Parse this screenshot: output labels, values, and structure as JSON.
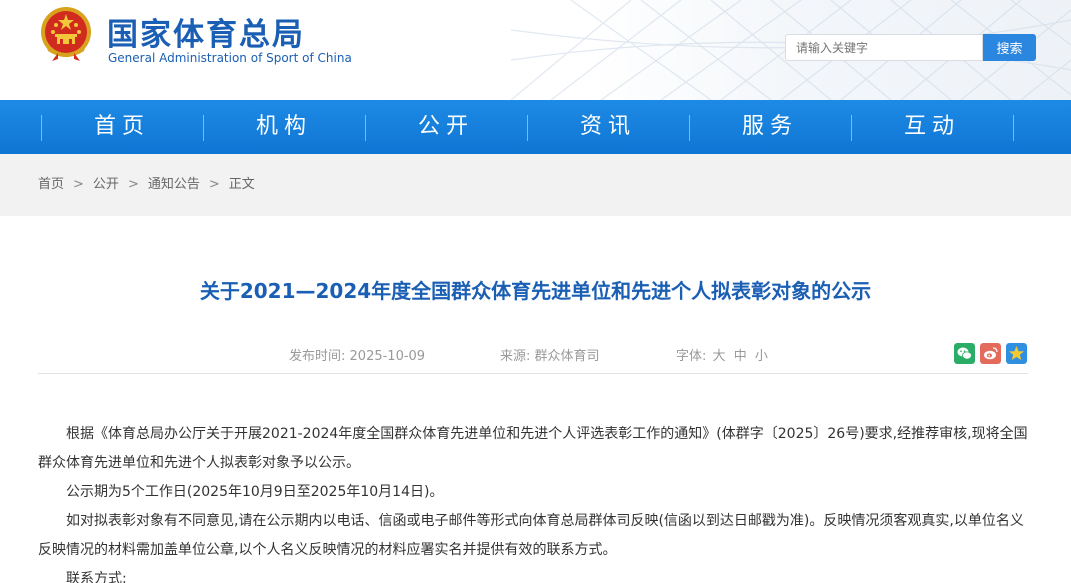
{
  "header": {
    "logo_cn": "国家体育总局",
    "logo_en": "General Administration of Sport of China",
    "search_placeholder": "请输入关键字",
    "search_button": "搜索"
  },
  "nav": {
    "items": [
      {
        "label": "首页"
      },
      {
        "label": "机构"
      },
      {
        "label": "公开"
      },
      {
        "label": "资讯"
      },
      {
        "label": "服务"
      },
      {
        "label": "互动"
      }
    ]
  },
  "breadcrumb": {
    "items": [
      "首页",
      "公开",
      "通知公告",
      "正文"
    ],
    "separator": ">"
  },
  "article": {
    "title": "关于2021—2024年度全国群众体育先进单位和先进个人拟表彰对象的公示",
    "date_label": "发布时间:",
    "date": "2025-10-09",
    "source_label": "来源:",
    "source": "群众体育司",
    "font_label": "字体:",
    "font_options": [
      "大",
      "中",
      "小"
    ],
    "paragraphs": [
      "根据《体育总局办公厅关于开展2021-2024年度全国群众体育先进单位和先进个人评选表彰工作的通知》(体群字〔2025〕26号)要求,经推荐审核,现将全国群众体育先进单位和先进个人拟表彰对象予以公示。",
      "公示期为5个工作日(2025年10月9日至2025年10月14日)。",
      "如对拟表彰对象有不同意见,请在公示期内以电话、信函或电子邮件等形式向体育总局群体司反映(信函以到达日邮戳为准)。反映情况须客观真实,以单位名义反映情况的材料需加盖单位公章,以个人名义反映情况的材料应署实名并提供有效的联系方式。",
      "联系方式:"
    ]
  },
  "colors": {
    "brand_blue": "#1a5fb4",
    "nav_blue": "#1075d4",
    "search_blue": "#2b86e0",
    "wechat_green": "#2aae67",
    "weibo_red": "#e46b5c",
    "qzone_blue": "#2f8fe0"
  },
  "icons": [
    "national-emblem-icon",
    "wechat-icon",
    "weibo-icon",
    "qzone-star-icon"
  ]
}
